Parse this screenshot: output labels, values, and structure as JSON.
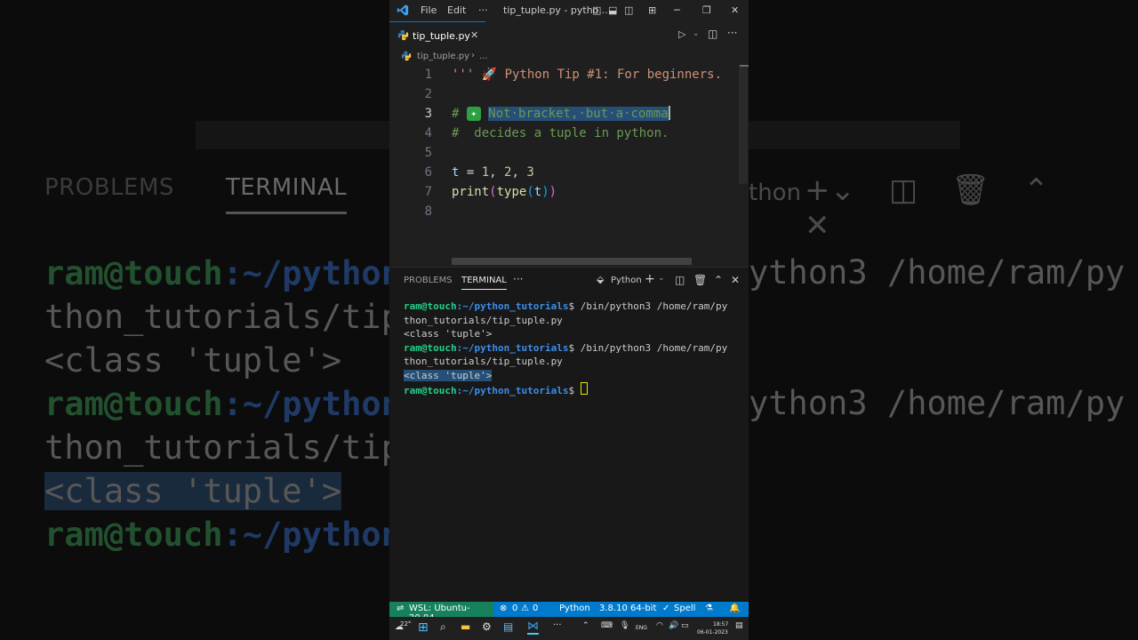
{
  "background": {
    "tabs": [
      "PROBLEMS",
      "TERMINAL"
    ],
    "right_tab": "thon",
    "lines": [
      {
        "user": "ram@touch",
        "path": ":~/python_",
        "rest": ""
      },
      {
        "text": "thon_tutorials/tip_"
      },
      {
        "text": "<class 'tuple'>"
      },
      {
        "user": "ram@touch",
        "path": ":~/python_",
        "rest": ""
      },
      {
        "text": "thon_tutorials/tip_"
      },
      {
        "text": "<class 'tuple'>"
      },
      {
        "user": "ram@touch",
        "path": ":~/python_",
        "rest": ""
      }
    ],
    "right_lines": [
      "ython3 /home/ram/py",
      "ython3 /home/ram/py"
    ]
  },
  "titlebar": {
    "menu_file": "File",
    "menu_edit": "Edit",
    "more": "···",
    "title": "tip_tuple.py - pytho..."
  },
  "tab": {
    "filename": "tip_tuple.py"
  },
  "breadcrumb": {
    "file": "tip_tuple.py",
    "sep": "›",
    "rest": "..."
  },
  "editor": {
    "lines": [
      {
        "n": "1",
        "text": "''' 🚀 Python Tip #1: For beginners."
      },
      {
        "n": "2",
        "text": ""
      },
      {
        "n": "3",
        "prefix": "# ",
        "emoji": "✦",
        "selected": "Not·bracket,·but·a·comma"
      },
      {
        "n": "4",
        "text": "#  decides a tuple in python."
      },
      {
        "n": "5",
        "text": ""
      },
      {
        "n": "6",
        "code": {
          "v": "t",
          "eq": " = ",
          "a": "1",
          "c1": ", ",
          "b": "2",
          "c2": ", ",
          "c": "3"
        }
      },
      {
        "n": "7",
        "code": {
          "f": "print",
          "o1": "(",
          "g": "type",
          "o2": "(",
          "v": "t",
          "c2": ")",
          "c1": ")"
        }
      },
      {
        "n": "8",
        "text": ""
      }
    ]
  },
  "panel": {
    "tabs": [
      "PROBLEMS",
      "TERMINAL"
    ],
    "more": "···",
    "shell": "Python",
    "terminal": [
      {
        "user": "ram@touch",
        "path": ":~/python_tutorials",
        "cmd": "$ /bin/python3 /home/ram/py"
      },
      {
        "text": "thon_tutorials/tip_tuple.py"
      },
      {
        "text": "<class 'tuple'>"
      },
      {
        "user": "ram@touch",
        "path": ":~/python_tutorials",
        "cmd": "$ /bin/python3 /home/ram/py"
      },
      {
        "text": "thon_tutorials/tip_tuple.py"
      },
      {
        "text": "<class 'tuple'>",
        "highlight": true
      },
      {
        "user": "ram@touch",
        "path": ":~/python_tutorials",
        "cmd": "$ "
      }
    ]
  },
  "statusbar": {
    "remote": "WSL: Ubuntu-20.04",
    "errors": "0",
    "warnings": "0",
    "language": "Python",
    "interpreter": "3.8.10 64-bit",
    "spell": "Spell"
  },
  "taskbar": {
    "weather": "22°",
    "lang": "ENG",
    "time": "18:57",
    "date": "06-01-2023"
  },
  "colors": {
    "accent": "#007acc",
    "remote": "#16825d",
    "comment": "#6a9955",
    "string": "#ce9178",
    "selection": "#264f78"
  }
}
